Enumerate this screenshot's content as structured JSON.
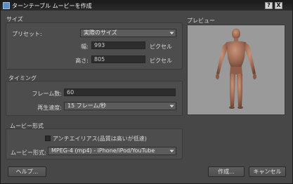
{
  "window": {
    "title": "ターンテーブル ムービーを作成",
    "help_btn": "?",
    "close_btn": "X"
  },
  "size": {
    "group_title": "サイズ",
    "preset_label": "プリセット:",
    "preset_value": "実際のサイズ",
    "width_label": "幅:",
    "width_value": "993",
    "height_label": "高さ:",
    "height_value": "805",
    "unit_width": "ピクセル",
    "unit_height": "ピクセル"
  },
  "timing": {
    "group_title": "タイミング",
    "frames_label": "フレーム数:",
    "frames_value": "60",
    "speed_label": "再生速度:",
    "speed_value": "15 フレーム/秒"
  },
  "movie": {
    "group_title": "ムービー形式",
    "antialias_label": "アンチエイリアス(品質は高いが低速)",
    "format_label": "ムービー形式:",
    "format_value": "MPEG-4 (mp4) - iPhone/iPod/YouTube"
  },
  "preview": {
    "title": "プレビュー"
  },
  "footer": {
    "help_label": "ヘルプ...",
    "create_label": "作成...",
    "cancel_label": "キャンセル"
  },
  "icons": {
    "arrow": "chevron-down-icon",
    "figure": "human-model-icon"
  }
}
